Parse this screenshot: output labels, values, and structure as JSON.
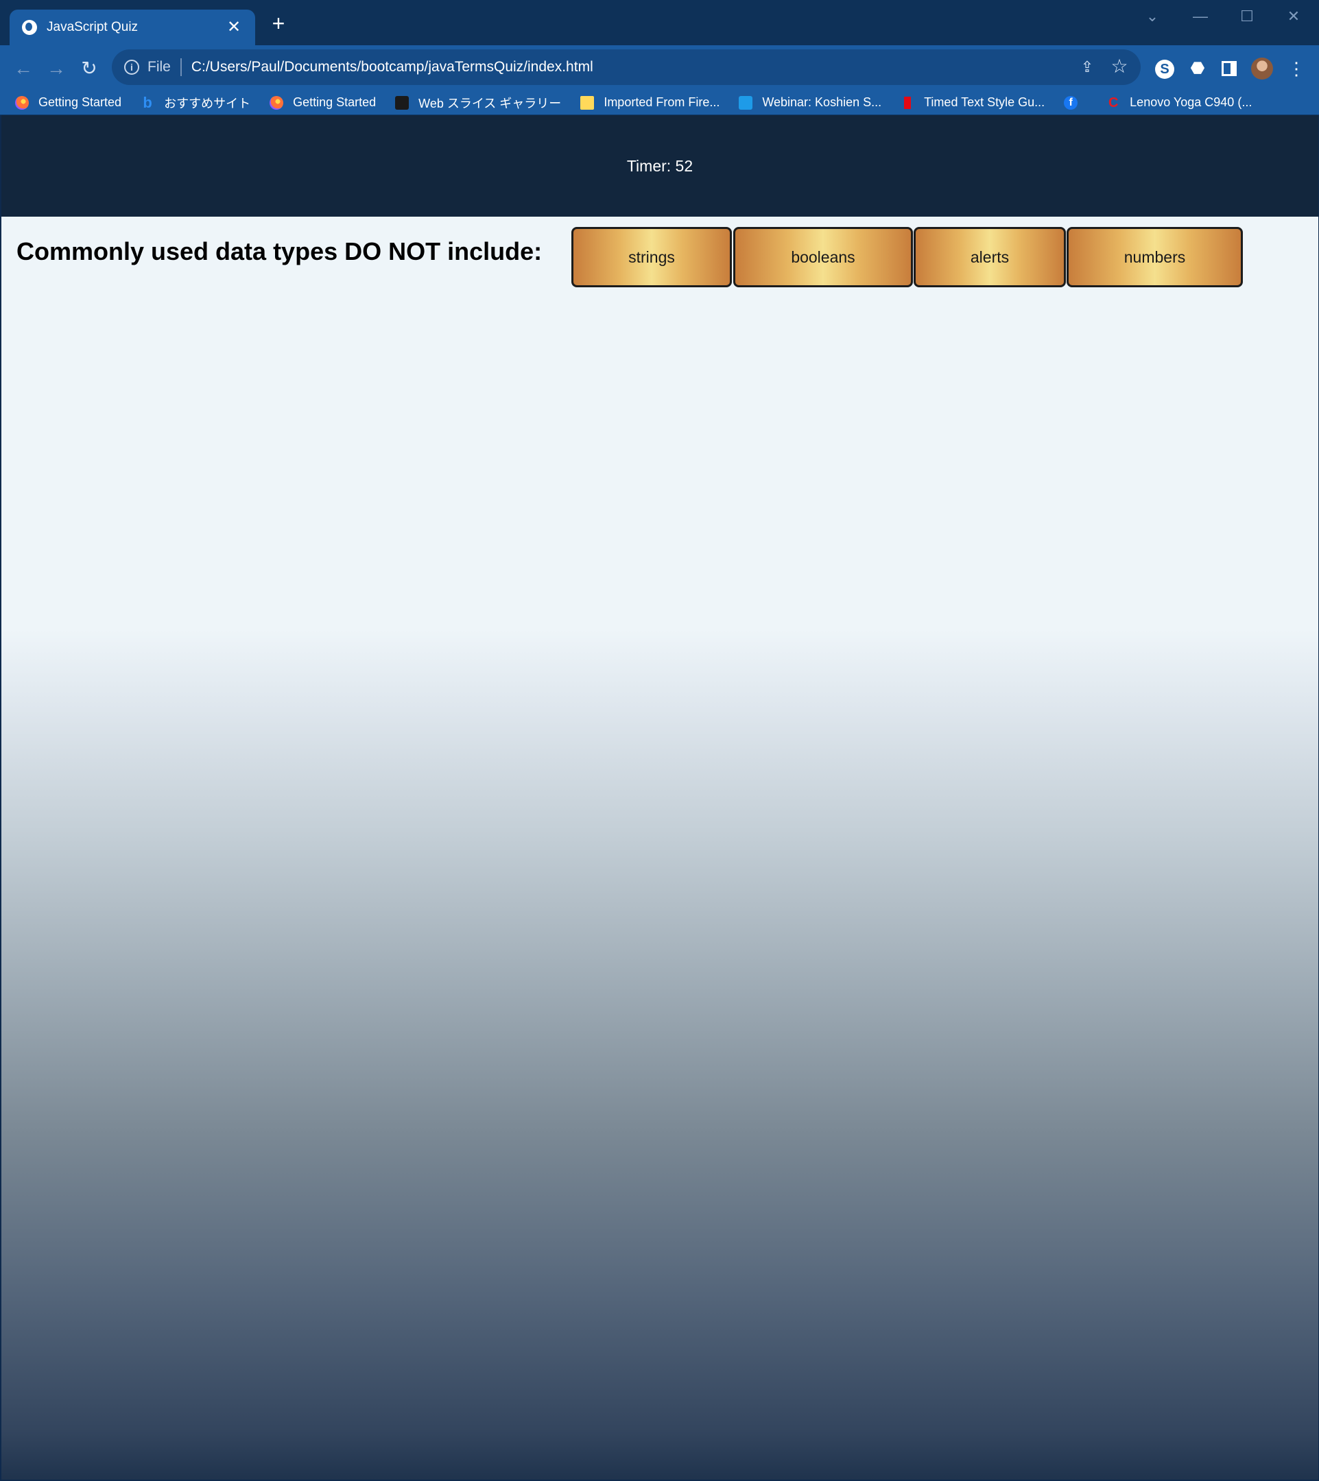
{
  "browser": {
    "tab": {
      "title": "JavaScript Quiz",
      "close_glyph": "✕"
    },
    "new_tab_glyph": "+",
    "omnibox": {
      "scheme_label": "File",
      "url": "C:/Users/Paul/Documents/bootcamp/javaTermsQuiz/index.html"
    },
    "icons": {
      "back": "←",
      "forward": "→",
      "reload": "↻",
      "share": "⇪",
      "star": "☆",
      "extension": "⬣",
      "menu": "⋮",
      "minimize": "—",
      "maximize": "☐",
      "close": "✕",
      "dropdown": "⌄",
      "info": "i",
      "s_extension": "S"
    },
    "bookmarks": [
      {
        "label": "Getting Started",
        "icon": "firefox-icon"
      },
      {
        "label": "おすすめサイト",
        "icon": "bing-icon"
      },
      {
        "label": "Getting Started",
        "icon": "firefox-icon"
      },
      {
        "label": "Web スライス ギャラリー",
        "icon": "slice-icon"
      },
      {
        "label": "Imported From Fire...",
        "icon": "folder-icon"
      },
      {
        "label": "Webinar: Koshien S...",
        "icon": "webinar-icon"
      },
      {
        "label": "Timed Text Style Gu...",
        "icon": "netflix-icon"
      },
      {
        "label": "",
        "icon": "facebook-icon"
      },
      {
        "label": "Lenovo Yoga C940 (...",
        "icon": "lenovo-icon"
      }
    ]
  },
  "page": {
    "timer_text": "Timer: 52",
    "question": "Commonly used data types DO NOT include:",
    "answers": [
      "strings",
      "booleans",
      "alerts",
      "numbers"
    ]
  },
  "colors": {
    "timer_bar": "#12263d",
    "button_gradient_edge": "#c87e3c",
    "button_gradient_center": "#f5e08e",
    "browser_chrome": "#1b5ca2"
  }
}
